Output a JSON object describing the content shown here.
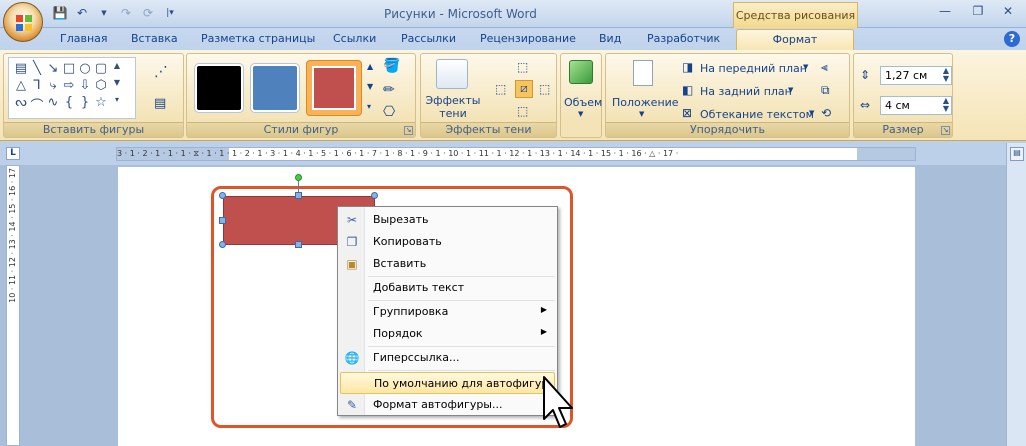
{
  "window": {
    "title": "Рисунки - Microsoft Word",
    "contextual_group": "Средства рисования"
  },
  "tabs": [
    "Главная",
    "Вставка",
    "Разметка страницы",
    "Ссылки",
    "Рассылки",
    "Рецензирование",
    "Вид",
    "Разработчик"
  ],
  "active_tab": "Формат",
  "ribbon": {
    "insert_shapes": {
      "label": "Вставить фигуры"
    },
    "shape_styles": {
      "label": "Стили фигур",
      "swatches": [
        "#000000",
        "#4f81bd",
        "#c0504d"
      ]
    },
    "shadow": {
      "effects_label": "Эффекты\nтени",
      "label": "Эффекты тени"
    },
    "volume": {
      "label": "Объем"
    },
    "arrange": {
      "position_label": "Положение",
      "bring_front": "На передний план",
      "send_back": "На задний план",
      "text_wrap": "Обтекание текстом",
      "label": "Упорядочить"
    },
    "size": {
      "height": "1,27 см",
      "width": "4 см",
      "label": "Размер"
    }
  },
  "ruler": {
    "h_numbers": "3 · 1 · 2 · 1 · 1 · 1 · ⧖ · 1 · 1 · 1 · 2 · 1 · 3 · 1 · 4 · 1 · 5 · 1 · 6 · 1 · 7 · 1 · 8 · 1 · 9 · 1 · 10 · 1 · 11 · 1 · 12 · 1 · 13 · 1 · 14 · 1 · 15 · 1 · 16 · △ · 17 ·",
    "v_numbers": "10 · 11 · 12 · 13 · 14 · 15 · 16 · 17"
  },
  "context_menu": {
    "items": [
      {
        "label": "Вырезать",
        "icon": "scissors-icon",
        "glyph": "✂"
      },
      {
        "label": "Копировать",
        "icon": "copy-icon",
        "glyph": "❐"
      },
      {
        "label": "Вставить",
        "icon": "paste-icon",
        "glyph": "📋"
      },
      {
        "label": "Добавить текст",
        "icon": "",
        "glyph": ""
      },
      {
        "label": "Группировка",
        "icon": "",
        "glyph": "",
        "submenu": "▶"
      },
      {
        "label": "Порядок",
        "icon": "",
        "glyph": "",
        "submenu": "▶"
      },
      {
        "label": "Гиперссылка...",
        "icon": "hyperlink-icon",
        "glyph": "🌐"
      },
      {
        "label": "По умолчанию для автофигур",
        "icon": "",
        "glyph": ""
      },
      {
        "label": "Формат автофигуры...",
        "icon": "format-shape-icon",
        "glyph": "✎"
      }
    ]
  },
  "colors": {
    "accent_frame": "#e0542a",
    "shape_fill": "#c0504d",
    "hover": "#ffe7a2"
  }
}
